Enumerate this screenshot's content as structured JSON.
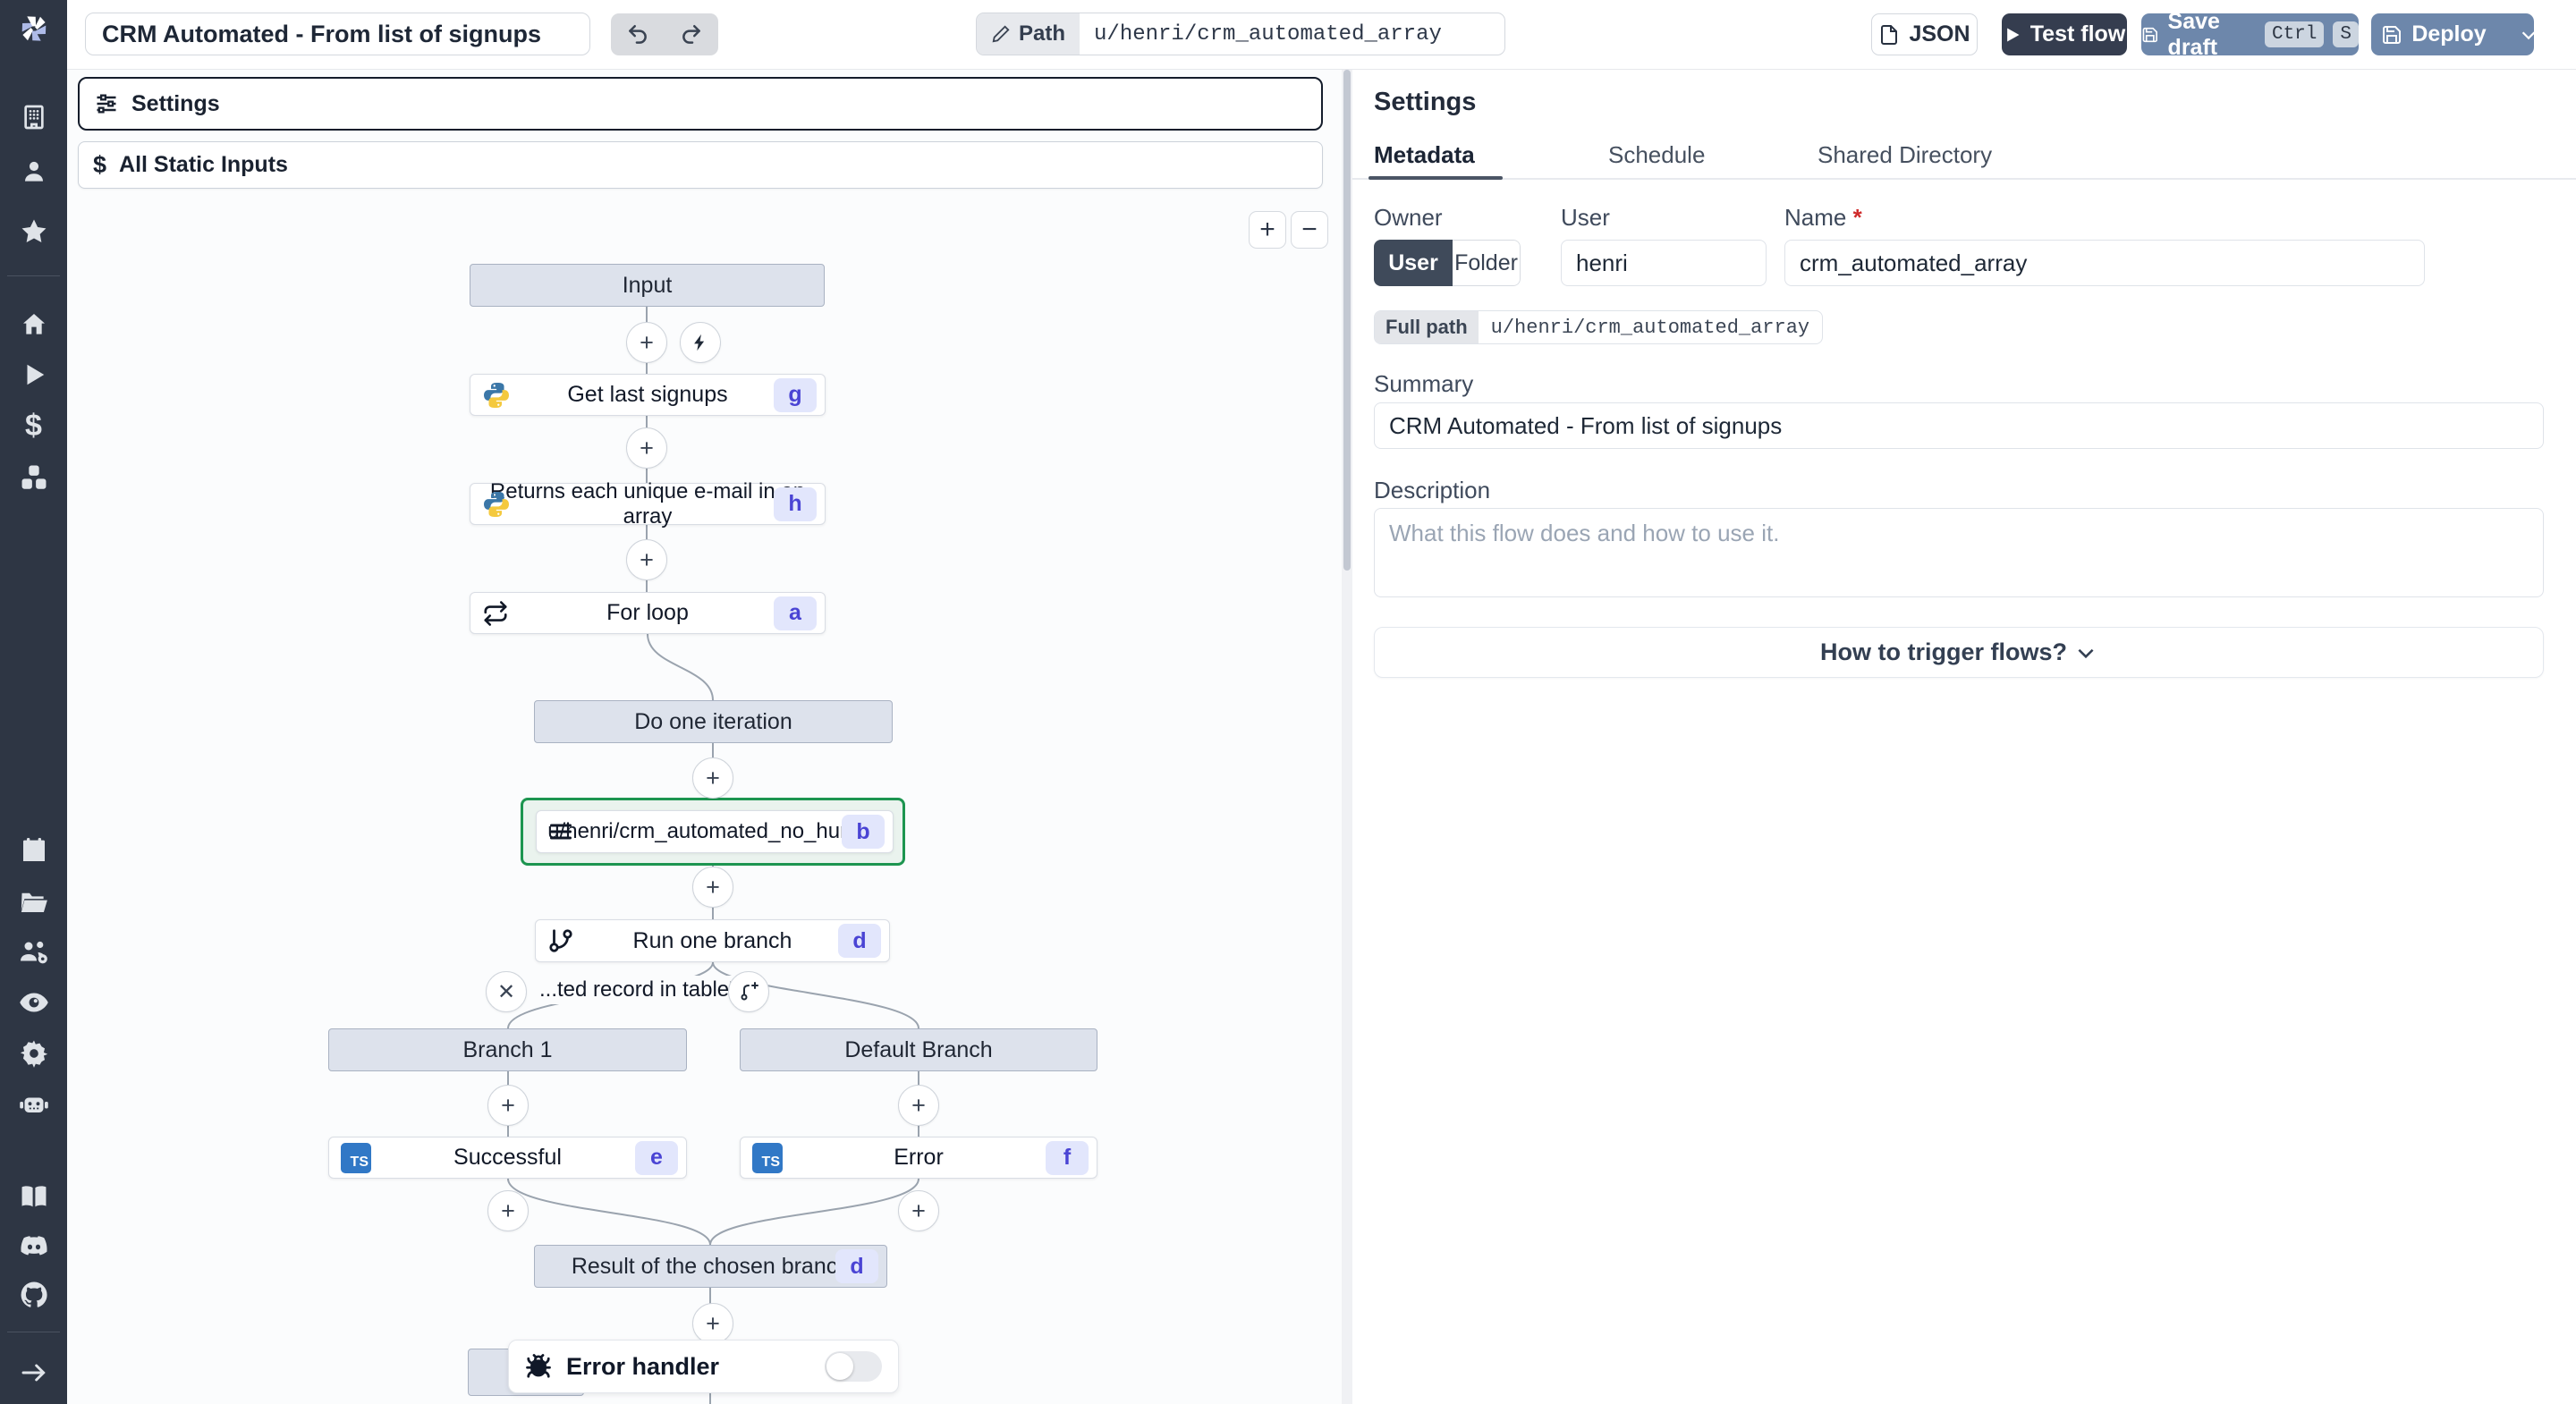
{
  "topbar": {
    "title": "CRM Automated - From list of signups",
    "path_label": "Path",
    "path_value": "u/henri/crm_automated_array",
    "json_label": "JSON",
    "test_flow_label": "Test flow",
    "save_draft_label": "Save draft",
    "kbd_ctrl": "Ctrl",
    "kbd_s": "S",
    "deploy_label": "Deploy"
  },
  "flow_panel": {
    "settings_label": "Settings",
    "static_inputs_label": "All Static Inputs",
    "zoom_in": "+",
    "zoom_out": "−"
  },
  "graph": {
    "input_label": "Input",
    "get_signups": {
      "label": "Get last signups",
      "badge": "g"
    },
    "returns_emails": {
      "label": "Returns each unique e-mail in an array",
      "badge": "h"
    },
    "for_loop": {
      "label": "For loop",
      "badge": "a"
    },
    "iteration_label": "Do one iteration",
    "subflow": {
      "label": "u/henri/crm_automated_no_human",
      "badge": "b"
    },
    "run_branch": {
      "label": "Run one branch",
      "badge": "d"
    },
    "condition_label": "...ted record in table'",
    "branch1_label": "Branch 1",
    "default_branch_label": "Default Branch",
    "successful": {
      "label": "Successful",
      "badge": "e"
    },
    "error": {
      "label": "Error",
      "badge": "f"
    },
    "result": {
      "label": "Result of the chosen branch",
      "badge": "d"
    },
    "error_handler_label": "Error handler",
    "ts_icon_text": "TS"
  },
  "right_panel": {
    "heading": "Settings",
    "tabs": [
      "Metadata",
      "Schedule",
      "Shared Directory"
    ],
    "owner_label": "Owner",
    "owner_user": "User",
    "owner_folder": "Folder",
    "user_label": "User",
    "user_value": "henri",
    "name_label": "Name",
    "name_required": "*",
    "name_value": "crm_automated_array",
    "full_path_label": "Full path",
    "full_path_value": "u/henri/crm_automated_array",
    "summary_label": "Summary",
    "summary_value": "CRM Automated - From list of signups",
    "description_label": "Description",
    "description_placeholder": "What this flow does and how to use it.",
    "trigger_button": "How to trigger flows?"
  },
  "colors": {
    "accent_dark": "#353d4f",
    "accent_blue": "#6d87ab",
    "selected_green": "#1d9550",
    "badge_bg": "#e2e6fc",
    "badge_text": "#4a44d4",
    "ts_blue": "#3178c6"
  }
}
